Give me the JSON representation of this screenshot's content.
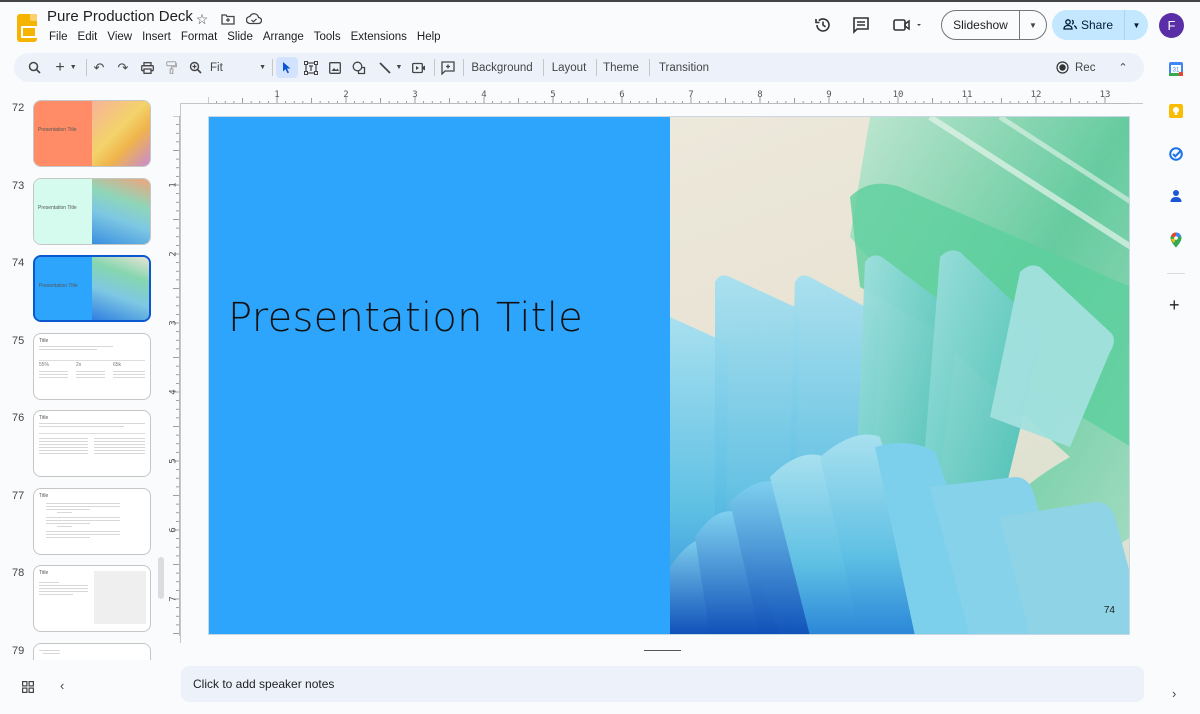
{
  "header": {
    "doc_title": "Pure Production Deck",
    "title_icons": [
      "star-icon",
      "move-to-folder-icon",
      "cloud-saved-icon"
    ],
    "menu": [
      "File",
      "Edit",
      "View",
      "Insert",
      "Format",
      "Slide",
      "Arrange",
      "Tools",
      "Extensions",
      "Help"
    ],
    "slideshow_label": "Slideshow",
    "share_label": "Share",
    "avatar_initial": "F"
  },
  "toolbar": {
    "zoom_value": "Fit",
    "background_label": "Background",
    "layout_label": "Layout",
    "theme_label": "Theme",
    "transition_label": "Transition",
    "rec_label": "Rec"
  },
  "side_panel": {
    "apps": [
      "Calendar",
      "Keep",
      "Tasks",
      "Contacts",
      "Maps"
    ],
    "colors": {
      "calendar": "#4285f4",
      "keep": "#fbbc04",
      "tasks": "#1a73e8",
      "contacts": "#1a57d6",
      "maps": "#34a853"
    }
  },
  "filmstrip": {
    "slides": [
      {
        "number": "72",
        "title": "Presentation Title",
        "left_color": "#ff8c66",
        "right_color": "#f0c060",
        "kind": "title"
      },
      {
        "number": "73",
        "title": "Presentation Title",
        "left_color": "#d4fbee",
        "right_color": "#7ec8e3",
        "kind": "title"
      },
      {
        "number": "74",
        "title": "Presentation Title",
        "left_color": "#2ea5fd",
        "right_color": "#7ec8e3",
        "kind": "title",
        "selected": true
      },
      {
        "number": "75",
        "title": "Title",
        "kind": "stats",
        "stats": [
          "55%",
          "2x",
          "65k"
        ]
      },
      {
        "number": "76",
        "title": "Title",
        "kind": "two-column"
      },
      {
        "number": "77",
        "title": "Title",
        "kind": "bullets"
      },
      {
        "number": "78",
        "title": "Title",
        "kind": "text-image"
      },
      {
        "number": "79",
        "title": "",
        "kind": "partial"
      }
    ]
  },
  "rulers": {
    "horizontal_labels": [
      "1",
      "2",
      "3",
      "4",
      "5",
      "6",
      "7",
      "8",
      "9",
      "10",
      "11",
      "12",
      "13"
    ],
    "vertical_labels": [
      "1",
      "2",
      "3",
      "4",
      "5",
      "6",
      "7"
    ]
  },
  "slide": {
    "title": "Presentation Title",
    "number": "74",
    "left_color": "#2ea5fd"
  },
  "notes": {
    "placeholder": "Click to add speaker notes"
  }
}
